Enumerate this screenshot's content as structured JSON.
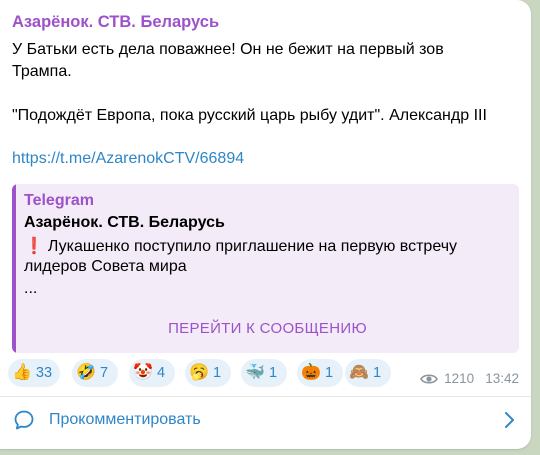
{
  "post": {
    "channel_name": "Азарёнок. СТВ. Беларусь",
    "line1": "У Батьки есть дела поважнее! Он не бежит на первый зов",
    "line2": "Трампа.",
    "line3": "\"Подождёт Европа, пока русский царь рыбу удит\". Александр III",
    "link": "https://t.me/AzarenokCTV/66894"
  },
  "quote": {
    "source": "Telegram",
    "title": "Азарёнок. СТВ. Беларусь",
    "exclamation": "❗",
    "line1": "Лукашенко поступило приглашение на первую встречу",
    "line2": "лидеров Совета мира",
    "line3": "...",
    "button_label": "ПЕРЕЙТИ К СООБЩЕНИЮ"
  },
  "reactions": [
    {
      "emoji": "👍",
      "count": "33",
      "icon": "thumbs-up-icon"
    },
    {
      "emoji": "🤣",
      "count": "7",
      "icon": "rolling-laughing-icon"
    },
    {
      "emoji": "🤡",
      "count": "4",
      "icon": "clown-icon"
    },
    {
      "emoji": "🥱",
      "count": "1",
      "icon": "yawning-face-icon"
    },
    {
      "emoji": "🐳",
      "count": "1",
      "icon": "whale-icon"
    },
    {
      "emoji": "🎃",
      "count": "1",
      "icon": "pumpkin-icon"
    },
    {
      "emoji": "🙈",
      "count": "1",
      "icon": "see-no-evil-monkey-icon"
    }
  ],
  "meta": {
    "views": "1210",
    "time": "13:42"
  },
  "comments": {
    "label": "Прокомментировать"
  },
  "colors": {
    "accent": "#9d52c9",
    "link": "#2f86c7",
    "background": "#c9d7c1",
    "quote_bg": "#f3ebf8",
    "reaction_bg": "#e7f1fa"
  }
}
